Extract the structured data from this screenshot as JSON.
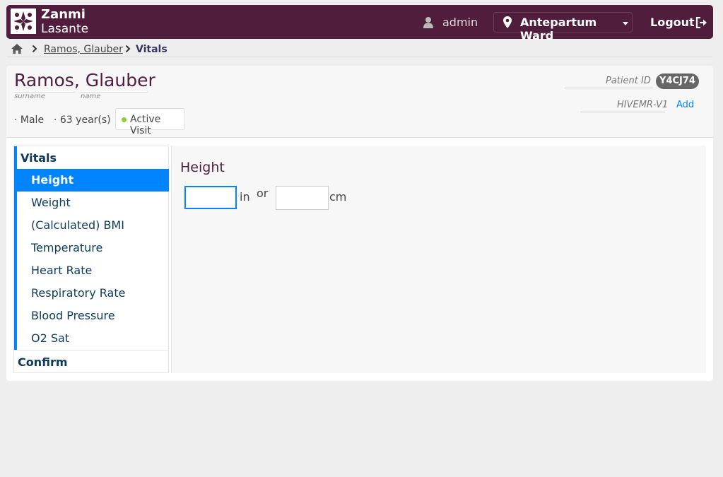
{
  "header": {
    "brand_line1": "Zanmi",
    "brand_line2": "Lasante",
    "user": "admin",
    "location": "Antepartum Ward",
    "logout": "Logout",
    "bg_color": "#501d3d"
  },
  "breadcrumb": {
    "patient": "Ramos, Glauber",
    "current": "Vitals"
  },
  "patient": {
    "surname": "Ramos,",
    "given_name": "Glauber",
    "surname_label": "surname",
    "name_label": "name",
    "gender": "· Male",
    "age": "· 63 year(s)",
    "visit_status": "Active Visit",
    "id_label": "Patient ID",
    "id_value": "Y4CJ74",
    "hiv_label": "HIVEMR-V1",
    "hiv_add": "Add"
  },
  "sidebar": {
    "section_vitals": "Vitals",
    "items": [
      {
        "label": "Height",
        "active": true
      },
      {
        "label": "Weight"
      },
      {
        "label": "(Calculated) BMI"
      },
      {
        "label": "Temperature"
      },
      {
        "label": "Heart Rate"
      },
      {
        "label": "Respiratory Rate"
      },
      {
        "label": "Blood Pressure"
      },
      {
        "label": "O2 Sat"
      }
    ],
    "section_confirm": "Confirm",
    "accent_color": "#0084ff"
  },
  "form": {
    "title": "Height",
    "in_value": "",
    "in_unit": "in",
    "or_text": "or",
    "cm_value": "",
    "cm_unit": "cm"
  }
}
